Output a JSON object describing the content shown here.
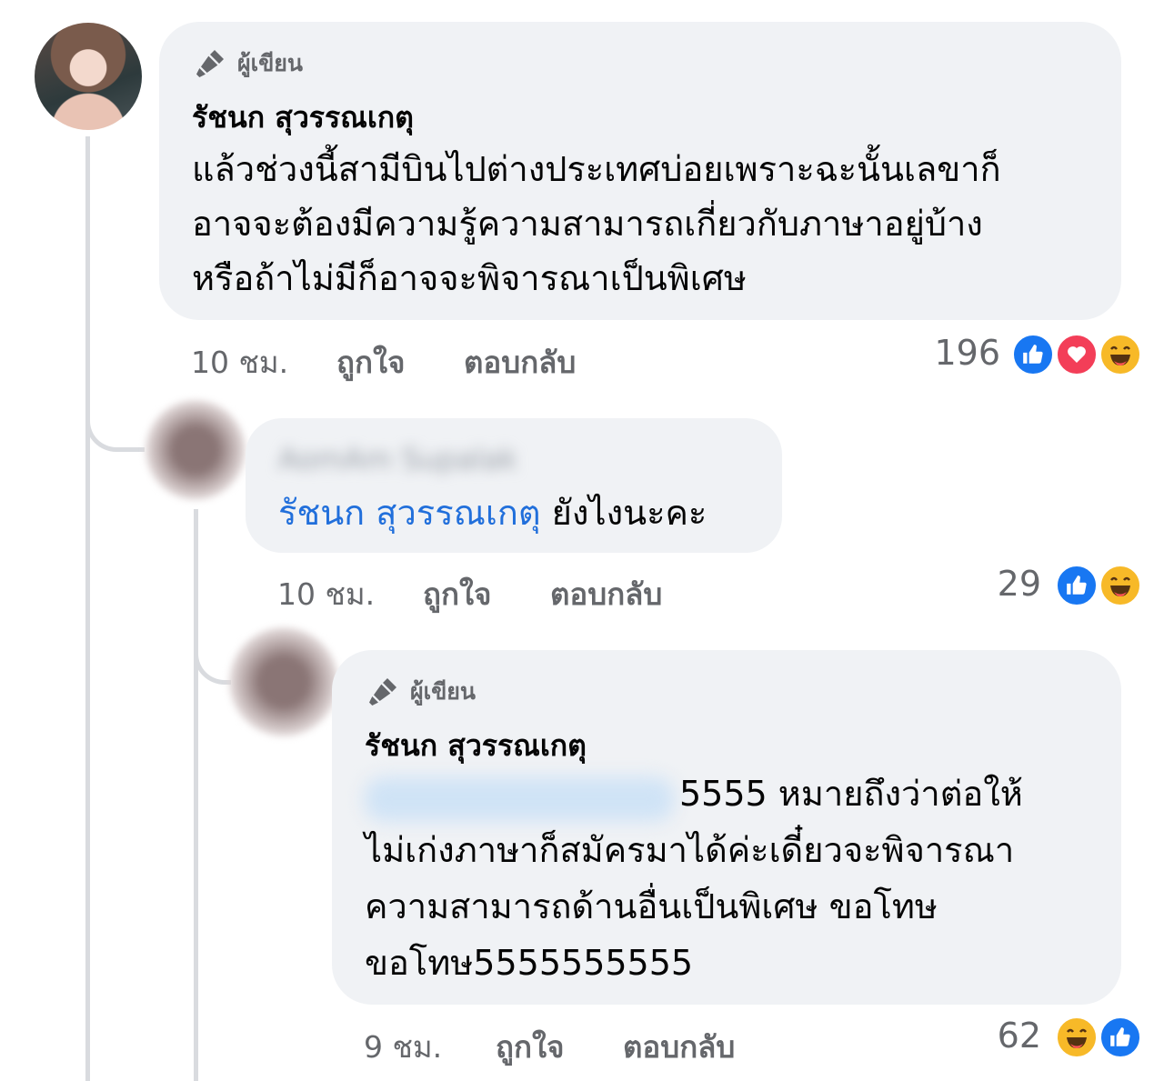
{
  "comment1": {
    "badge": "ผู้เขียน",
    "author": "รัชนก สุวรรณเกตุ",
    "lines": [
      "แล้วช่วงนี้สามีบินไปต่างประเทศบ่อยเพราะฉะนั้นเลขาก็",
      "อาจจะต้องมีความรู้ความสามารถเกี่ยวกับภาษาอยู่บ้าง",
      "หรือถ้าไม่มีก็อาจจะพิจารณาเป็นพิเศษ"
    ],
    "time": "10 ชม.",
    "like": "ถูกใจ",
    "reply": "ตอบกลับ",
    "reaction_count": "196",
    "reactions": [
      "like-icon",
      "love-icon",
      "haha-icon"
    ]
  },
  "comment2": {
    "author": "AomAm Supalak",
    "mention": "รัชนก สุวรรณเกตุ",
    "text": "ยังไงนะคะ",
    "time": "10 ชม.",
    "like": "ถูกใจ",
    "reply": "ตอบกลับ",
    "reaction_count": "29",
    "reactions": [
      "like-icon",
      "haha-icon"
    ]
  },
  "comment3": {
    "badge": "ผู้เขียน",
    "author": "รัชนก สุวรรณเกตุ",
    "line1": "5555 หมายถึงว่าต่อให้",
    "lines": [
      "ไม่เก่งภาษาก็สมัครมาได้ค่ะเดี๋ยวจะพิจารณา",
      "ความสามารถด้านอื่นเป็นพิเศษ ขอโทษ",
      "ขอโทษ5555555555"
    ],
    "time": "9 ชม.",
    "like": "ถูกใจ",
    "reply": "ตอบกลับ",
    "reaction_count": "62",
    "reactions": [
      "haha-icon",
      "like-icon"
    ]
  },
  "colors": {
    "bubble": "#f0f2f5",
    "meta": "#65676b",
    "mention": "#216fdb",
    "like": "#1877f2",
    "love": "#f33e58",
    "haha": "#f7b928"
  }
}
